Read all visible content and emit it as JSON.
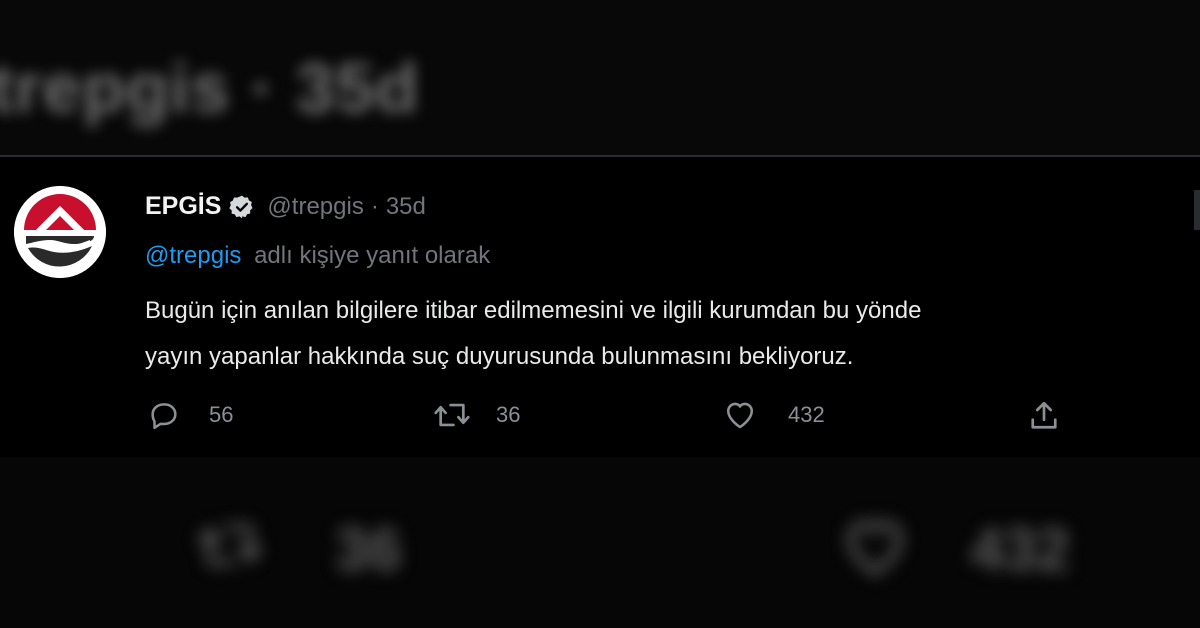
{
  "background_blur": {
    "top_text": "trepgis · 35d",
    "bottom_retweets": "36",
    "bottom_likes": "432"
  },
  "tweet": {
    "author_name": "EPGİS",
    "handle": "@trepgis",
    "separator": "·",
    "time": "35d",
    "reply_to_handle": "@trepgis",
    "reply_to_text": "adlı kişiye yanıt olarak",
    "body_line1": "Bugün için anılan bilgilere itibar edilmemesini ve ilgili kurumdan bu yönde",
    "body_line2": "yayın yapanlar hakkında suç duyurusunda bulunmasını bekliyoruz.",
    "replies": "56",
    "retweets": "36",
    "likes": "432",
    "icons": {
      "verified": "verified-badge-icon",
      "reply": "reply-bubble-icon",
      "retweet": "retweet-icon",
      "like": "heart-icon",
      "share": "share-upload-icon"
    }
  },
  "colors": {
    "background": "#000000",
    "text": "#e7e9ea",
    "secondary": "#71767b",
    "link": "#1d9bf0",
    "logo_red": "#c8102e"
  }
}
